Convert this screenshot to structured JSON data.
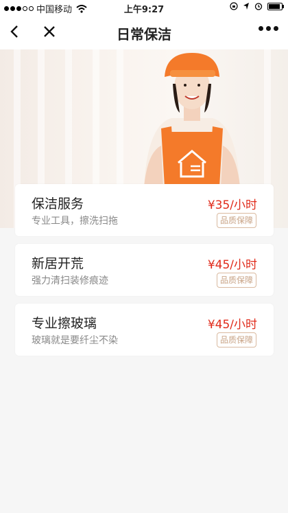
{
  "status_bar": {
    "carrier": "中国移动",
    "time": "上午9:27"
  },
  "nav": {
    "title": "日常保洁"
  },
  "services": [
    {
      "title": "保洁服务",
      "desc": "专业工具，擦洗扫拖",
      "price": "¥35/小时",
      "badge": "品质保障"
    },
    {
      "title": "新居开荒",
      "desc": "强力清扫装修痕迹",
      "price": "¥45/小时",
      "badge": "品质保障"
    },
    {
      "title": "专业擦玻璃",
      "desc": "玻璃就是要纤尘不染",
      "price": "¥45/小时",
      "badge": "品质保障"
    }
  ],
  "colors": {
    "accent_price": "#e02a1a",
    "badge": "#c9a487",
    "uniform_orange": "#f47a2a"
  },
  "icons": [
    "signal-dots-icon",
    "wifi-icon",
    "back-icon",
    "close-icon",
    "more-icon",
    "home-logo-icon"
  ]
}
